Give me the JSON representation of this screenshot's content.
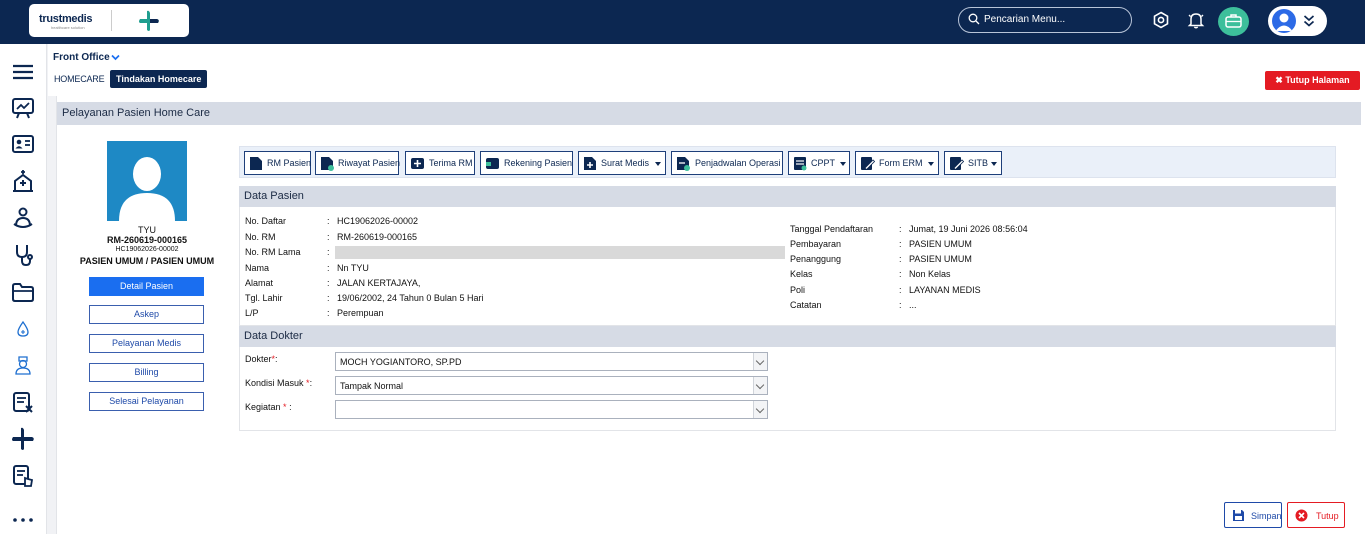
{
  "app": {
    "logo_text": "trustmedis",
    "logo_tagline": "healthcare solution"
  },
  "topbar": {
    "search_placeholder": "Pencarian Menu..."
  },
  "header": {
    "module": "Front Office",
    "breadcrumb_1": "HOMECARE",
    "breadcrumb_2": "Tindakan Homecare",
    "close_page": "✖ Tutup Halaman"
  },
  "panel": {
    "title": "Pelayanan Pasien Home Care"
  },
  "patient": {
    "name": "TYU",
    "rm": "RM-260619-000165",
    "daftar": "HC19062026-00002",
    "payer": "PASIEN UMUM / PASIEN UMUM"
  },
  "side_buttons": [
    "Detail Pasien",
    "Askep",
    "Pelayanan Medis",
    "Billing",
    "Selesai Pelayanan"
  ],
  "toolbar": {
    "rm_pasien": "RM Pasien",
    "riwayat": "Riwayat Pasien",
    "terima_rm": "Terima RM",
    "rekening": "Rekening Pasien",
    "surat_medis": "Surat Medis",
    "penjadwalan": "Penjadwalan Operasi",
    "cppt": "CPPT",
    "form_erm": "Form ERM",
    "sitb": "SITB"
  },
  "data_pasien": {
    "title": "Data Pasien",
    "left": [
      {
        "label": "No. Daftar",
        "value": "HC19062026-00002"
      },
      {
        "label": "No. RM",
        "value": "RM-260619-000165"
      },
      {
        "label": "No. RM Lama",
        "value": ""
      },
      {
        "label": "Nama",
        "value": "Nn TYU"
      },
      {
        "label": "Alamat",
        "value": "JALAN KERTAJAYA,"
      },
      {
        "label": "Tgl. Lahir",
        "value": "19/06/2002, 24 Tahun 0 Bulan 5 Hari"
      },
      {
        "label": "L/P",
        "value": "Perempuan"
      }
    ],
    "right": [
      {
        "label": "Tanggal Pendaftaran",
        "value": "Jumat, 19 Juni 2026 08:56:04"
      },
      {
        "label": "Pembayaran",
        "value": "PASIEN UMUM"
      },
      {
        "label": "Penanggung",
        "value": "PASIEN UMUM"
      },
      {
        "label": "Kelas",
        "value": "Non Kelas"
      },
      {
        "label": "Poli",
        "value": "LAYANAN MEDIS"
      },
      {
        "label": "Catatan",
        "value": "..."
      }
    ]
  },
  "data_dokter": {
    "title": "Data Dokter",
    "dokter_label": "Dokter",
    "dokter_value": "MOCH YOGIANTORO, SP.PD",
    "kondisi_label": "Kondisi Masuk",
    "kondisi_value": "Tampak Normal",
    "kegiatan_label": "Kegiatan",
    "kegiatan_value": ""
  },
  "actions": {
    "save": "Simpan",
    "close": "Tutup"
  },
  "colors": {
    "navy": "#0c2751",
    "accent_green": "#3dbf9b",
    "primary_blue": "#1a6ef0",
    "danger": "#e41b23"
  }
}
